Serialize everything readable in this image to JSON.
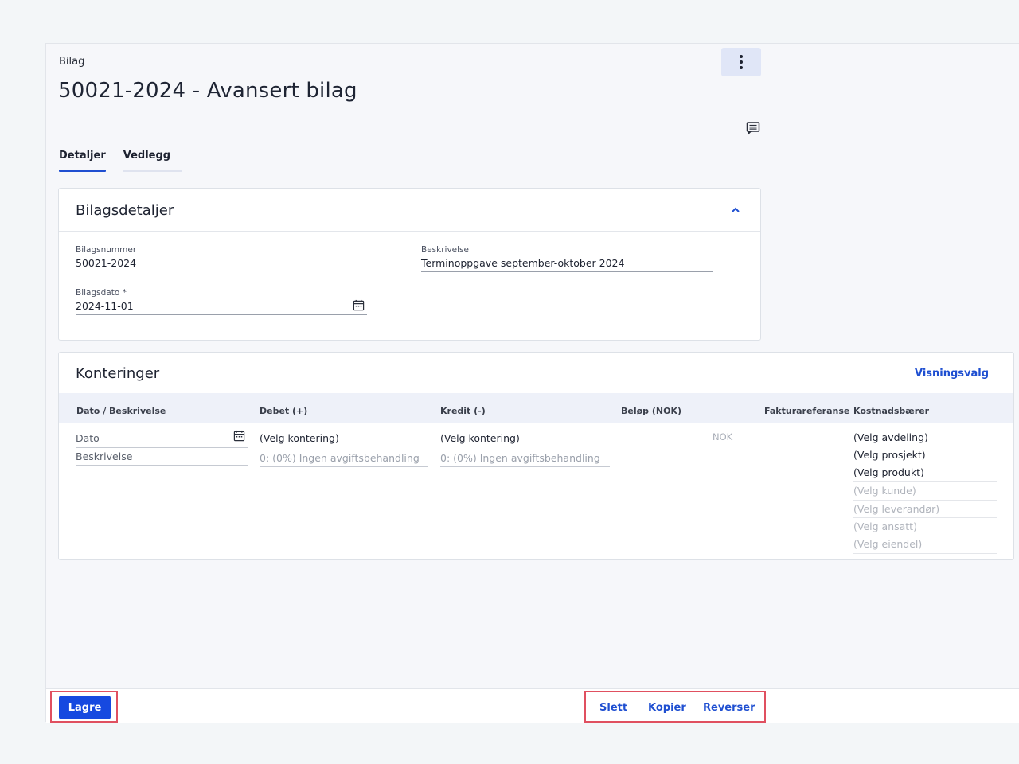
{
  "header": {
    "breadcrumb": "Bilag",
    "title": "50021-2024 - Avansert bilag"
  },
  "tabs": [
    {
      "label": "Detaljer",
      "active": true
    },
    {
      "label": "Vedlegg",
      "active": false
    }
  ],
  "details": {
    "title": "Bilagsdetaljer",
    "bilagsnummer_label": "Bilagsnummer",
    "bilagsnummer_value": "50021-2024",
    "beskrivelse_label": "Beskrivelse",
    "beskrivelse_value": "Terminoppgave september-oktober 2024",
    "bilagsdato_label": "Bilagsdato *",
    "bilagsdato_value": "2024-11-01"
  },
  "konteringer": {
    "title": "Konteringer",
    "view_options_link": "Visningsvalg",
    "columns": [
      "Dato / Beskrivelse",
      "Debet (+)",
      "Kredit (-)",
      "Beløp (NOK)",
      "Fakturareferanse",
      "Kostnadsbærer"
    ],
    "row": {
      "date_placeholder": "Dato",
      "description_placeholder": "Beskrivelse",
      "debet_select": "(Velg kontering)",
      "debet_vat": "0: (0%) Ingen avgiftsbehandling",
      "kredit_select": "(Velg kontering)",
      "kredit_vat": "0: (0%) Ingen avgiftsbehandling",
      "amount_placeholder": "NOK",
      "cost_carriers_active": [
        "(Velg avdeling)",
        "(Velg prosjekt)",
        "(Velg produkt)"
      ],
      "cost_carriers_inactive": [
        "(Velg kunde)",
        "(Velg leverandør)",
        "(Velg ansatt)",
        "(Velg eiendel)"
      ]
    }
  },
  "footer": {
    "save_label": "Lagre",
    "delete_label": "Slett",
    "copy_label": "Kopier",
    "reverse_label": "Reverser"
  },
  "colors": {
    "accent": "#1f4fd1",
    "primary_button": "#1649e0",
    "highlight_border": "#e05060"
  }
}
